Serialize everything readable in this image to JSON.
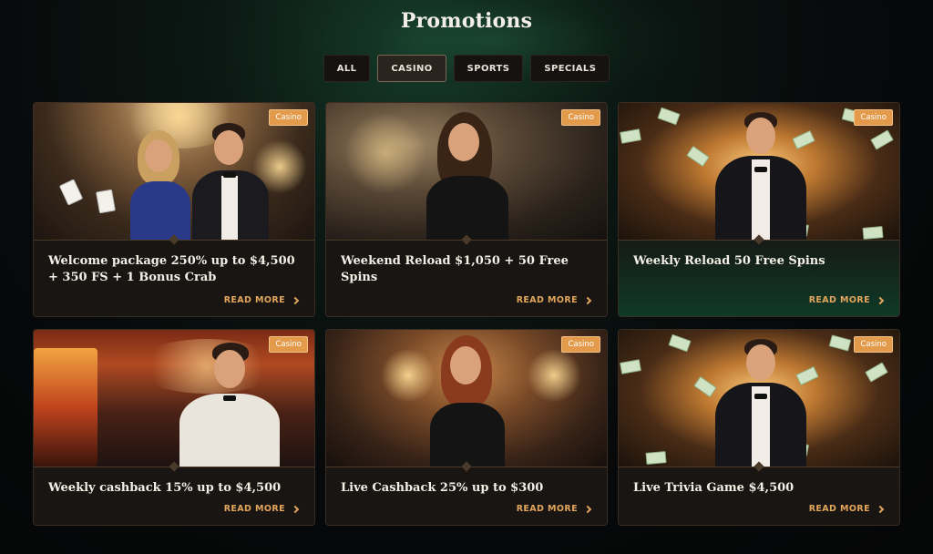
{
  "page": {
    "title": "Promotions"
  },
  "tabs": [
    {
      "label": "ALL",
      "active": false
    },
    {
      "label": "CASINO",
      "active": true
    },
    {
      "label": "SPORTS",
      "active": false
    },
    {
      "label": "SPECIALS",
      "active": false
    }
  ],
  "promotions": [
    {
      "title": "Welcome package 250% up to $4,500 + 350 FS + 1 Bonus Crab",
      "badge": "Casino",
      "cta": "READ MORE"
    },
    {
      "title": "Weekend Reload $1,050 + 50 Free Spins",
      "badge": "Casino",
      "cta": "READ MORE"
    },
    {
      "title": "Weekly Reload 50 Free Spins",
      "badge": "Casino",
      "cta": "READ MORE"
    },
    {
      "title": "Weekly cashback 15% up to $4,500",
      "badge": "Casino",
      "cta": "READ MORE"
    },
    {
      "title": "Live Cashback 25% up to $300",
      "badge": "Casino",
      "cta": "READ MORE"
    },
    {
      "title": "Live Trivia Game $4,500",
      "badge": "Casino",
      "cta": "READ MORE"
    }
  ],
  "colors": {
    "accent": "#e2a55c",
    "badge": "#e39a4a",
    "background": "#07090a"
  }
}
